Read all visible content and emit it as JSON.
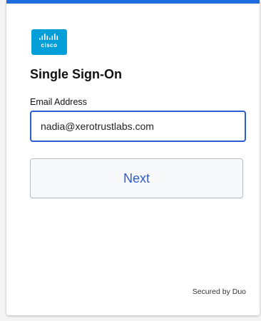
{
  "brand": {
    "logo_text": "cisco",
    "logo_icon": "cisco-logo-icon",
    "logo_color": "#049fd9",
    "accent_color": "#1e6be0"
  },
  "page": {
    "title": "Single Sign-On"
  },
  "email": {
    "label": "Email Address",
    "value": "nadia@xerotrustlabs.com"
  },
  "actions": {
    "next_label": "Next"
  },
  "footer": {
    "secured_by": "Secured by Duo"
  }
}
